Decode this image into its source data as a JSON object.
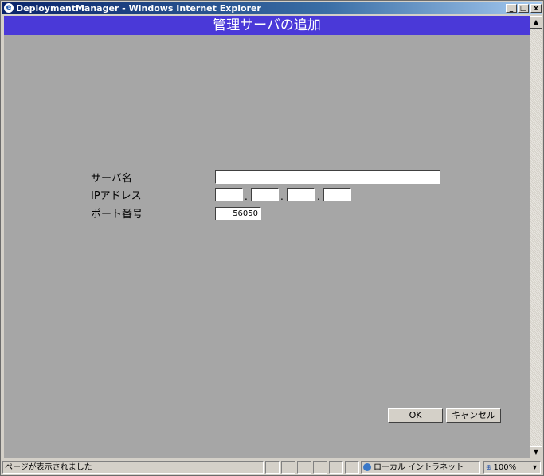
{
  "window": {
    "title": "DeploymentManager - Windows Internet Explorer",
    "min_glyph": "_",
    "max_glyph": "□",
    "close_glyph": "x"
  },
  "page": {
    "heading": "管理サーバの追加"
  },
  "form": {
    "server_name_label": "サーバ名",
    "server_name_value": "",
    "ip_label": "IPアドレス",
    "ip_octets": [
      "",
      "",
      "",
      ""
    ],
    "ip_separator": ".",
    "port_label": "ポート番号",
    "port_value": "56050"
  },
  "buttons": {
    "ok": "OK",
    "cancel": "キャンセル"
  },
  "statusbar": {
    "message": "ページが表示されました",
    "zone": "ローカル イントラネット",
    "zoom": "100%",
    "zoom_dropdown": "▾"
  },
  "colors": {
    "heading_band": "#4a39d8",
    "content_bg": "#a6a6a6"
  }
}
